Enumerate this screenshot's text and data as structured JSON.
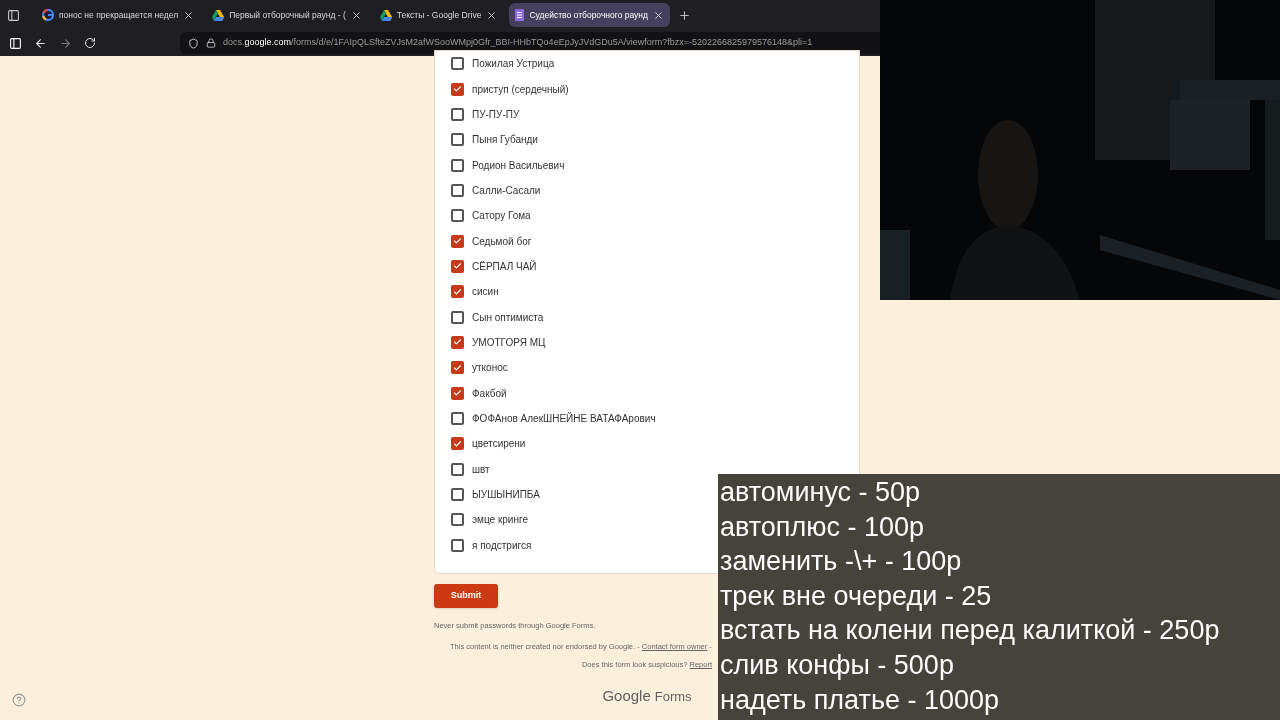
{
  "browser": {
    "tabs": [
      {
        "title": "понос не прекращается недел",
        "kind": "google",
        "selected": false
      },
      {
        "title": "Первый отборочный раунд - (",
        "kind": "drive",
        "selected": false
      },
      {
        "title": "Тексты - Google Drive",
        "kind": "drive",
        "selected": false
      },
      {
        "title": "Судейство отборочного раунд",
        "kind": "forms",
        "selected": true
      }
    ],
    "url": "docs.**google.com**/forms/d/e/1FAIpQLSfteZVJsM2afWSooWMpj0Gfr_BBI-HHbTQo4eEpJyJVdGDu5A/viewform?fbzx=-5202266825979576148&pli=1"
  },
  "form": {
    "options": [
      {
        "label": "Пожилая Устрица",
        "checked": false
      },
      {
        "label": "приступ (сердечный)",
        "checked": true
      },
      {
        "label": "ПУ-ПУ-ПУ",
        "checked": false
      },
      {
        "label": "Пыня Губанди",
        "checked": false
      },
      {
        "label": "Родион Васильевич",
        "checked": false
      },
      {
        "label": "Салли-Сасали",
        "checked": false
      },
      {
        "label": "Сатору Гома",
        "checked": false
      },
      {
        "label": "Седьмой бог",
        "checked": true
      },
      {
        "label": "СЁРПАЛ ЧАЙ",
        "checked": true
      },
      {
        "label": "сисин",
        "checked": true
      },
      {
        "label": "Сын оптимиста",
        "checked": false
      },
      {
        "label": "УМОТГОРЯ МЦ",
        "checked": true
      },
      {
        "label": "утконос",
        "checked": true
      },
      {
        "label": "Факбой",
        "checked": true
      },
      {
        "label": "ФОФАнов АлекШНЕЙНЕ ВАТАФАрович",
        "checked": false
      },
      {
        "label": "цветсирени",
        "checked": true
      },
      {
        "label": "швт",
        "checked": false
      },
      {
        "label": "ЫУШЫНИПБА",
        "checked": false
      },
      {
        "label": "эмце кринге",
        "checked": false
      },
      {
        "label": "я подстригся",
        "checked": false
      }
    ],
    "submit": "Submit",
    "notice": "Never submit passwords through Google Forms.",
    "disclaimer": "This content is neither created nor endorsed by Google. -",
    "contact_link": "Contact form owner",
    "disclaimer_tail": "-",
    "suspicious": "Does this form look suspicious?",
    "report_link": "Report",
    "brand_google": "Google",
    "brand_forms": "Forms"
  },
  "price_list": [
    "автоминус - 50р",
    "автоплюс - 100р",
    "заменить -\\+ - 100р",
    "трек вне очереди - 25",
    "встать на колени перед калиткой - 250р",
    "слив конфы - 500р",
    "надеть платье - 1000р"
  ]
}
